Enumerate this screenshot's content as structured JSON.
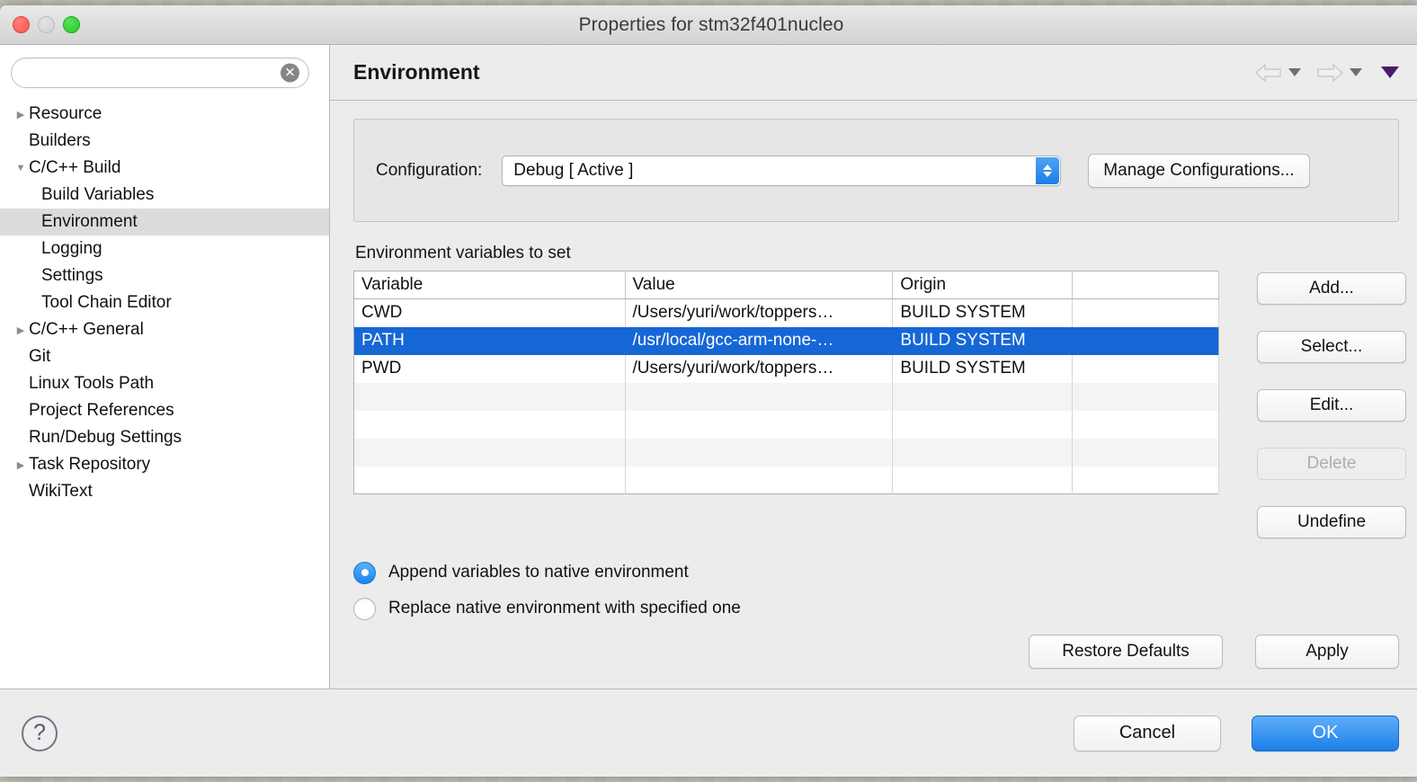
{
  "window": {
    "title": "Properties for stm32f401nucleo",
    "traffic_lights": [
      "close-button",
      "minimize-button",
      "zoom-button"
    ]
  },
  "sidebar": {
    "search": {
      "value": "",
      "placeholder": "",
      "clear_icon": "clear-icon"
    },
    "tree": [
      {
        "label": "Resource",
        "depth": 0,
        "twisty": "collapsed",
        "selected": false
      },
      {
        "label": "Builders",
        "depth": 0,
        "twisty": "none",
        "selected": false
      },
      {
        "label": "C/C++ Build",
        "depth": 0,
        "twisty": "expanded",
        "selected": false
      },
      {
        "label": "Build Variables",
        "depth": 1,
        "twisty": "none",
        "selected": false
      },
      {
        "label": "Environment",
        "depth": 1,
        "twisty": "none",
        "selected": true
      },
      {
        "label": "Logging",
        "depth": 1,
        "twisty": "none",
        "selected": false
      },
      {
        "label": "Settings",
        "depth": 1,
        "twisty": "none",
        "selected": false
      },
      {
        "label": "Tool Chain Editor",
        "depth": 1,
        "twisty": "none",
        "selected": false
      },
      {
        "label": "C/C++ General",
        "depth": 0,
        "twisty": "collapsed",
        "selected": false
      },
      {
        "label": "Git",
        "depth": 0,
        "twisty": "none",
        "selected": false
      },
      {
        "label": "Linux Tools Path",
        "depth": 0,
        "twisty": "none",
        "selected": false
      },
      {
        "label": "Project References",
        "depth": 0,
        "twisty": "none",
        "selected": false
      },
      {
        "label": "Run/Debug Settings",
        "depth": 0,
        "twisty": "none",
        "selected": false
      },
      {
        "label": "Task Repository",
        "depth": 0,
        "twisty": "collapsed",
        "selected": false
      },
      {
        "label": "WikiText",
        "depth": 0,
        "twisty": "none",
        "selected": false
      }
    ]
  },
  "header": {
    "title": "Environment",
    "back_icon": "back-arrow-icon",
    "forward_icon": "forward-arrow-icon",
    "menu_icon": "view-menu-caret-icon"
  },
  "configuration": {
    "label": "Configuration:",
    "value": "Debug  [ Active ]",
    "manage_label": "Manage Configurations..."
  },
  "variables_section": {
    "title": "Environment variables to set",
    "columns": [
      "Variable",
      "Value",
      "Origin",
      ""
    ],
    "rows": [
      {
        "variable": "CWD",
        "value": "/Users/yuri/work/toppers…",
        "origin": "BUILD SYSTEM",
        "extra": "",
        "selected": false
      },
      {
        "variable": "PATH",
        "value": "/usr/local/gcc-arm-none-…",
        "origin": "BUILD SYSTEM",
        "extra": "",
        "selected": true
      },
      {
        "variable": "PWD",
        "value": "/Users/yuri/work/toppers…",
        "origin": "BUILD SYSTEM",
        "extra": "",
        "selected": false
      },
      {
        "variable": "",
        "value": "",
        "origin": "",
        "extra": "",
        "selected": false
      },
      {
        "variable": "",
        "value": "",
        "origin": "",
        "extra": "",
        "selected": false
      },
      {
        "variable": "",
        "value": "",
        "origin": "",
        "extra": "",
        "selected": false
      },
      {
        "variable": "",
        "value": "",
        "origin": "",
        "extra": "",
        "selected": false
      }
    ],
    "buttons": [
      {
        "label": "Add...",
        "name": "add-button",
        "disabled": false
      },
      {
        "label": "Select...",
        "name": "select-button",
        "disabled": false
      },
      {
        "label": "Edit...",
        "name": "edit-button",
        "disabled": false
      },
      {
        "label": "Delete",
        "name": "delete-button",
        "disabled": true
      },
      {
        "label": "Undefine",
        "name": "undefine-button",
        "disabled": false
      }
    ]
  },
  "radios": {
    "append": {
      "label": "Append variables to native environment",
      "checked": true
    },
    "replace": {
      "label": "Replace native environment with specified one",
      "checked": false
    }
  },
  "page_actions": {
    "restore_defaults": "Restore Defaults",
    "apply": "Apply"
  },
  "footer": {
    "help_icon": "help-question-icon",
    "cancel": "Cancel",
    "ok": "OK"
  },
  "colors": {
    "selection_blue": "#1667d6",
    "accent_blue": "#1b7ee8",
    "window_bg": "#ececec",
    "sidebar_bg": "#ffffff",
    "selected_row_sidebar": "#dcdcdc",
    "purple_caret": "#4b1a6b"
  }
}
